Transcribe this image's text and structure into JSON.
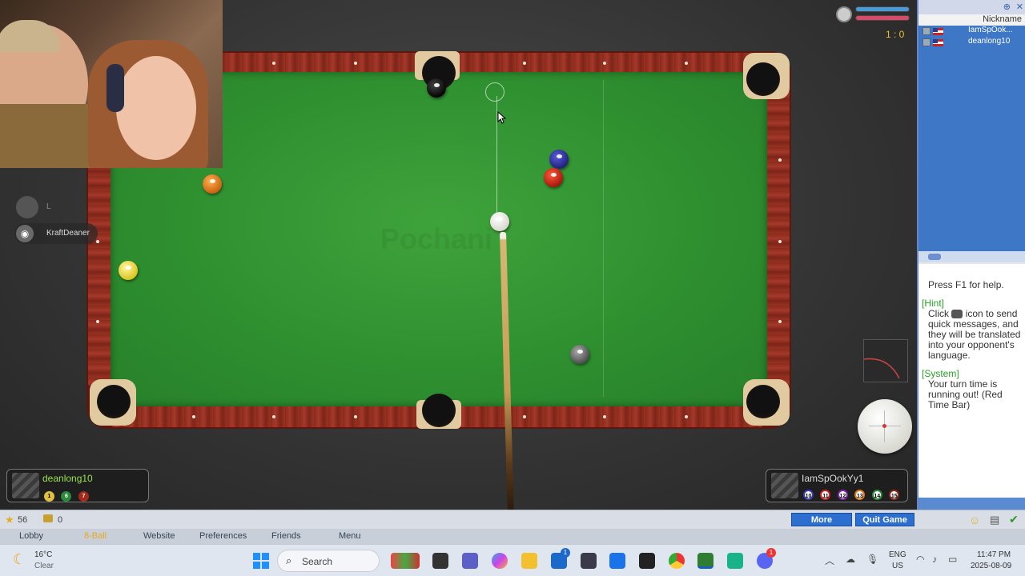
{
  "webcam_overlay": {
    "discord_users": [
      {
        "name": "L"
      },
      {
        "name": "KraftDeaner"
      }
    ]
  },
  "table": {
    "watermark": "Pochani"
  },
  "score": {
    "display": "1 : 0"
  },
  "players": {
    "left": {
      "name": "deanlong10",
      "balls": [
        "1",
        "6",
        "7"
      ]
    },
    "right": {
      "name": "IamSpOokYy1",
      "balls": [
        "10",
        "11",
        "12",
        "13",
        "14",
        "15"
      ]
    }
  },
  "sidebar": {
    "column_header": "Nickname",
    "player_list": [
      "IamSpOok...",
      "deanlong10"
    ],
    "chat": {
      "help": "Press F1 for help.",
      "hint_label": "[Hint]",
      "hint_text_1": "Click",
      "hint_text_2": "icon to send quick messages, and they will be translated into your opponent's language.",
      "system_label": "[System]",
      "system_text": "Your turn time is running out! (Red Time Bar)"
    }
  },
  "status": {
    "stars": "56",
    "coins": "0"
  },
  "buttons": {
    "more": "More",
    "quit": "Quit Game"
  },
  "nav": [
    "Lobby",
    "8-Ball",
    "Website",
    "Preferences",
    "Friends",
    "Menu"
  ],
  "taskbar": {
    "weather_temp": "16°C",
    "weather_desc": "Clear",
    "search_placeholder": "Search",
    "lang_1": "ENG",
    "lang_2": "US",
    "time": "11:47 PM",
    "date": "2025-08-09",
    "chat_badge": "1",
    "discord_badge": "1"
  },
  "colors": {
    "felt": "#2f9030",
    "rail": "#8a2a1c",
    "player_name": "#9be04a",
    "side_blue": "#3d77c5",
    "button_blue": "#2d6fd1"
  }
}
